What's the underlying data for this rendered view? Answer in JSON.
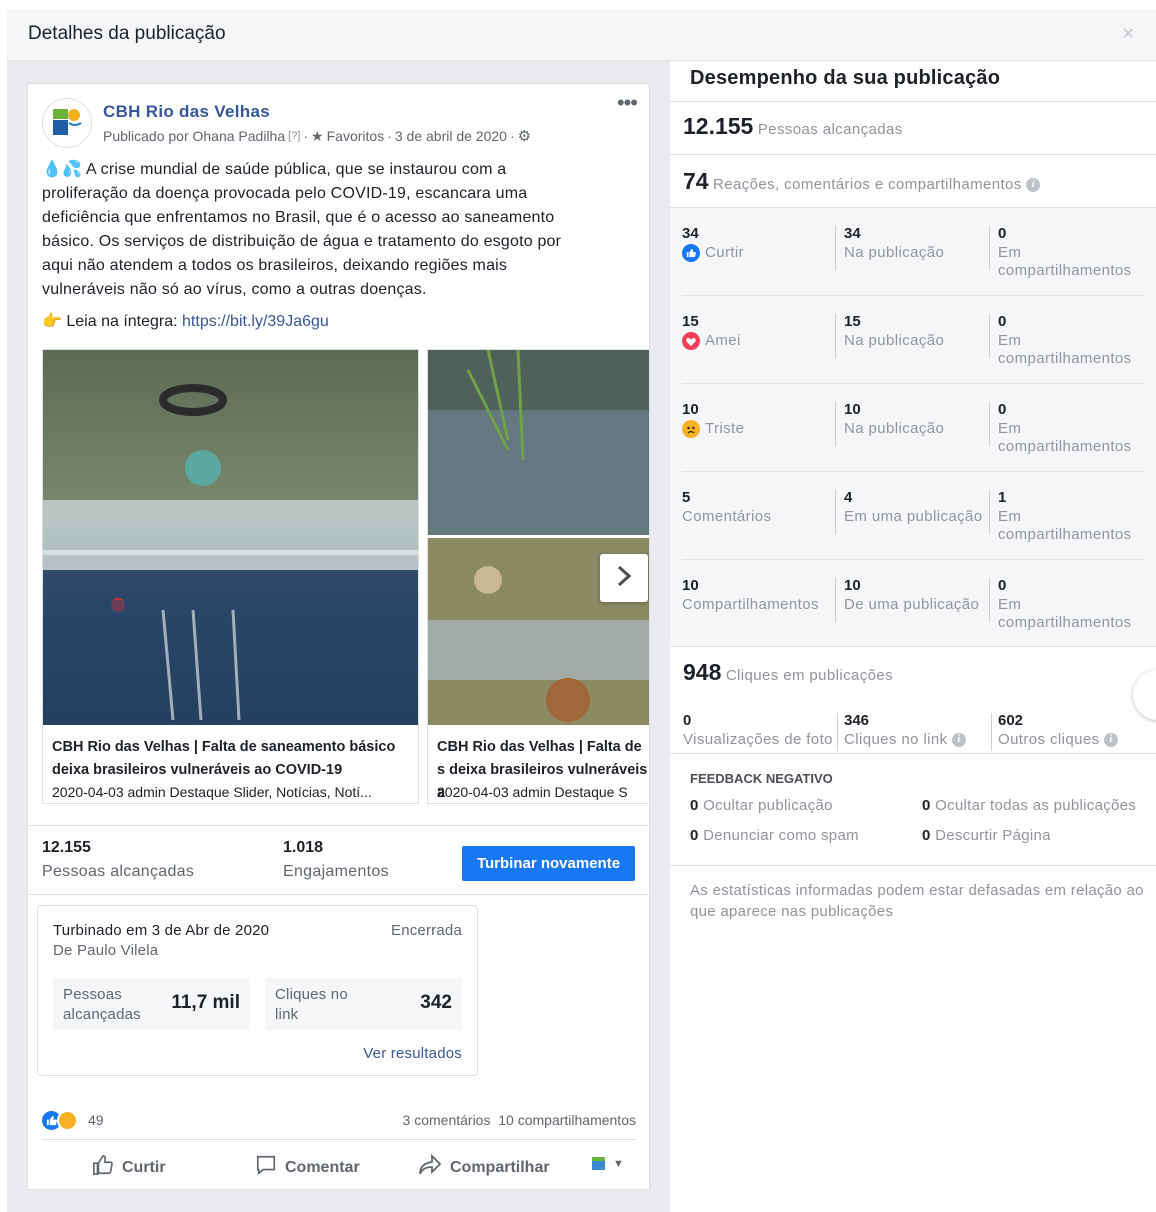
{
  "dialog": {
    "title": "Detalhes da publicação",
    "close_label": "×"
  },
  "post": {
    "page_name": "CBH Rio das Velhas",
    "published_by": "Publicado por Ohana Padilha",
    "help_badge": "[?]",
    "favorites": "Favoritos",
    "date": "3 de abril de 2020",
    "more_label": "•••",
    "text_lines": [
      "A crise mundial de saúde pública, que se instaurou com a",
      "proliferação da doença provocada pelo COVID-19, escancara uma",
      "deficiência que enfrentamos no Brasil, que é o acesso ao saneamento",
      "básico. Os serviços de distribuição de água e tratamento do esgoto por",
      "aqui não atendem a todos os brasileiros, deixando regiões mais",
      "vulneráveis não só ao vírus, como a outras doenças."
    ],
    "read_more_label": "Leia na íntegra:",
    "link": "https://bit.ly/39Ja6gu",
    "carousel": [
      {
        "title": "CBH Rio das Velhas | Falta de saneamento básico deixa brasileiros vulneráveis ao COVID-19",
        "subtitle": "2020-04-03 admin Destaque Slider, Notícias, Notí..."
      },
      {
        "title": "CBH Rio das Velhas | Falta de s deixa brasileiros vulneráveis a",
        "subtitle": "2020-04-03 admin Destaque S"
      }
    ],
    "stats": {
      "reach_value": "12.155",
      "reach_label": "Pessoas alcançadas",
      "engagement_value": "1.018",
      "engagement_label": "Engajamentos",
      "boost_button": "Turbinar novamente"
    },
    "boost": {
      "title": "Turbinado em 3 de Abr de 2020",
      "by": "De Paulo Vilela",
      "status": "Encerrada",
      "metric1_label_line1": "Pessoas",
      "metric1_label_line2": "alcançadas",
      "metric1_value": "11,7 mil",
      "metric2_label_line1": "Cliques no",
      "metric2_label_line2": "link",
      "metric2_value": "342",
      "results_link": "Ver resultados"
    },
    "reactions_count": "49",
    "comments_count": "3 comentários",
    "shares_count": "10 compartilhamentos",
    "actions": {
      "like": "Curtir",
      "comment": "Comentar",
      "share": "Compartilhar"
    }
  },
  "performance": {
    "title": "Desempenho da sua publicação",
    "reach_value": "12.155",
    "reach_label": "Pessoas alcançadas",
    "interactions_value": "74",
    "interactions_label": "Reações, comentários e compartilhamentos",
    "rows": [
      {
        "total": "34",
        "label": "Curtir",
        "icon": "like",
        "post_value": "34",
        "post_label": "Na publicação",
        "shares_value": "0",
        "shares_label_1": "Em",
        "shares_label_2": "compartilhamentos"
      },
      {
        "total": "15",
        "label": "Amei",
        "icon": "love",
        "post_value": "15",
        "post_label": "Na publicação",
        "shares_value": "0",
        "shares_label_1": "Em",
        "shares_label_2": "compartilhamentos"
      },
      {
        "total": "10",
        "label": "Triste",
        "icon": "sad",
        "post_value": "10",
        "post_label": "Na publicação",
        "shares_value": "0",
        "shares_label_1": "Em",
        "shares_label_2": "compartilhamentos"
      },
      {
        "total": "5",
        "label": "Comentários",
        "icon": "",
        "post_value": "4",
        "post_label": "Em uma publicação",
        "shares_value": "1",
        "shares_label_1": "Em",
        "shares_label_2": "compartilhamentos"
      },
      {
        "total": "10",
        "label": "Compartilhamentos",
        "icon": "",
        "post_value": "10",
        "post_label": "De uma publicação",
        "shares_value": "0",
        "shares_label_1": "Em",
        "shares_label_2": "compartilhamentos"
      }
    ],
    "clicks_value": "948",
    "clicks_label": "Cliques em publicações",
    "clicks": [
      {
        "value": "0",
        "label": "Visualizações de foto"
      },
      {
        "value": "346",
        "label": "Cliques no link"
      },
      {
        "value": "602",
        "label": "Outros cliques"
      }
    ],
    "negative_title": "FEEDBACK NEGATIVO",
    "negative": [
      {
        "value": "0",
        "label": "Ocultar publicação"
      },
      {
        "value": "0",
        "label": "Ocultar todas as publicações"
      },
      {
        "value": "0",
        "label": "Denunciar como spam"
      },
      {
        "value": "0",
        "label": "Descurtir Página"
      }
    ],
    "note": "As estatísticas informadas podem estar defasadas em relação ao que aparece nas publicações"
  },
  "colors": {
    "primary_button": "#1877f2",
    "link": "#385898",
    "page_name": "#365899",
    "love": "#f33e58",
    "sad": "#f7b125"
  }
}
